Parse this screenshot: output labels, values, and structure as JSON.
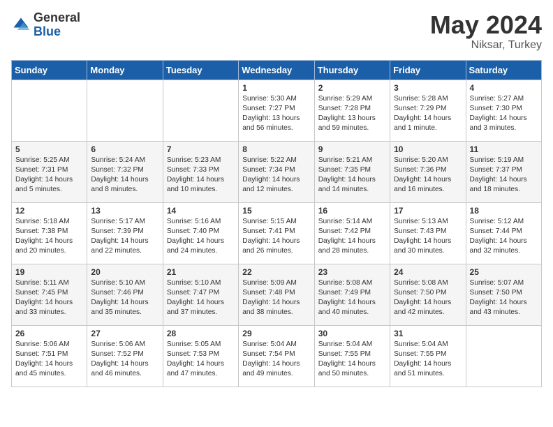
{
  "logo": {
    "general": "General",
    "blue": "Blue"
  },
  "title": "May 2024",
  "subtitle": "Niksar, Turkey",
  "days_header": [
    "Sunday",
    "Monday",
    "Tuesday",
    "Wednesday",
    "Thursday",
    "Friday",
    "Saturday"
  ],
  "weeks": [
    [
      {
        "day": "",
        "sunrise": "",
        "sunset": "",
        "daylight": ""
      },
      {
        "day": "",
        "sunrise": "",
        "sunset": "",
        "daylight": ""
      },
      {
        "day": "",
        "sunrise": "",
        "sunset": "",
        "daylight": ""
      },
      {
        "day": "1",
        "sunrise": "Sunrise: 5:30 AM",
        "sunset": "Sunset: 7:27 PM",
        "daylight": "Daylight: 13 hours and 56 minutes."
      },
      {
        "day": "2",
        "sunrise": "Sunrise: 5:29 AM",
        "sunset": "Sunset: 7:28 PM",
        "daylight": "Daylight: 13 hours and 59 minutes."
      },
      {
        "day": "3",
        "sunrise": "Sunrise: 5:28 AM",
        "sunset": "Sunset: 7:29 PM",
        "daylight": "Daylight: 14 hours and 1 minute."
      },
      {
        "day": "4",
        "sunrise": "Sunrise: 5:27 AM",
        "sunset": "Sunset: 7:30 PM",
        "daylight": "Daylight: 14 hours and 3 minutes."
      }
    ],
    [
      {
        "day": "5",
        "sunrise": "Sunrise: 5:25 AM",
        "sunset": "Sunset: 7:31 PM",
        "daylight": "Daylight: 14 hours and 5 minutes."
      },
      {
        "day": "6",
        "sunrise": "Sunrise: 5:24 AM",
        "sunset": "Sunset: 7:32 PM",
        "daylight": "Daylight: 14 hours and 8 minutes."
      },
      {
        "day": "7",
        "sunrise": "Sunrise: 5:23 AM",
        "sunset": "Sunset: 7:33 PM",
        "daylight": "Daylight: 14 hours and 10 minutes."
      },
      {
        "day": "8",
        "sunrise": "Sunrise: 5:22 AM",
        "sunset": "Sunset: 7:34 PM",
        "daylight": "Daylight: 14 hours and 12 minutes."
      },
      {
        "day": "9",
        "sunrise": "Sunrise: 5:21 AM",
        "sunset": "Sunset: 7:35 PM",
        "daylight": "Daylight: 14 hours and 14 minutes."
      },
      {
        "day": "10",
        "sunrise": "Sunrise: 5:20 AM",
        "sunset": "Sunset: 7:36 PM",
        "daylight": "Daylight: 14 hours and 16 minutes."
      },
      {
        "day": "11",
        "sunrise": "Sunrise: 5:19 AM",
        "sunset": "Sunset: 7:37 PM",
        "daylight": "Daylight: 14 hours and 18 minutes."
      }
    ],
    [
      {
        "day": "12",
        "sunrise": "Sunrise: 5:18 AM",
        "sunset": "Sunset: 7:38 PM",
        "daylight": "Daylight: 14 hours and 20 minutes."
      },
      {
        "day": "13",
        "sunrise": "Sunrise: 5:17 AM",
        "sunset": "Sunset: 7:39 PM",
        "daylight": "Daylight: 14 hours and 22 minutes."
      },
      {
        "day": "14",
        "sunrise": "Sunrise: 5:16 AM",
        "sunset": "Sunset: 7:40 PM",
        "daylight": "Daylight: 14 hours and 24 minutes."
      },
      {
        "day": "15",
        "sunrise": "Sunrise: 5:15 AM",
        "sunset": "Sunset: 7:41 PM",
        "daylight": "Daylight: 14 hours and 26 minutes."
      },
      {
        "day": "16",
        "sunrise": "Sunrise: 5:14 AM",
        "sunset": "Sunset: 7:42 PM",
        "daylight": "Daylight: 14 hours and 28 minutes."
      },
      {
        "day": "17",
        "sunrise": "Sunrise: 5:13 AM",
        "sunset": "Sunset: 7:43 PM",
        "daylight": "Daylight: 14 hours and 30 minutes."
      },
      {
        "day": "18",
        "sunrise": "Sunrise: 5:12 AM",
        "sunset": "Sunset: 7:44 PM",
        "daylight": "Daylight: 14 hours and 32 minutes."
      }
    ],
    [
      {
        "day": "19",
        "sunrise": "Sunrise: 5:11 AM",
        "sunset": "Sunset: 7:45 PM",
        "daylight": "Daylight: 14 hours and 33 minutes."
      },
      {
        "day": "20",
        "sunrise": "Sunrise: 5:10 AM",
        "sunset": "Sunset: 7:46 PM",
        "daylight": "Daylight: 14 hours and 35 minutes."
      },
      {
        "day": "21",
        "sunrise": "Sunrise: 5:10 AM",
        "sunset": "Sunset: 7:47 PM",
        "daylight": "Daylight: 14 hours and 37 minutes."
      },
      {
        "day": "22",
        "sunrise": "Sunrise: 5:09 AM",
        "sunset": "Sunset: 7:48 PM",
        "daylight": "Daylight: 14 hours and 38 minutes."
      },
      {
        "day": "23",
        "sunrise": "Sunrise: 5:08 AM",
        "sunset": "Sunset: 7:49 PM",
        "daylight": "Daylight: 14 hours and 40 minutes."
      },
      {
        "day": "24",
        "sunrise": "Sunrise: 5:08 AM",
        "sunset": "Sunset: 7:50 PM",
        "daylight": "Daylight: 14 hours and 42 minutes."
      },
      {
        "day": "25",
        "sunrise": "Sunrise: 5:07 AM",
        "sunset": "Sunset: 7:50 PM",
        "daylight": "Daylight: 14 hours and 43 minutes."
      }
    ],
    [
      {
        "day": "26",
        "sunrise": "Sunrise: 5:06 AM",
        "sunset": "Sunset: 7:51 PM",
        "daylight": "Daylight: 14 hours and 45 minutes."
      },
      {
        "day": "27",
        "sunrise": "Sunrise: 5:06 AM",
        "sunset": "Sunset: 7:52 PM",
        "daylight": "Daylight: 14 hours and 46 minutes."
      },
      {
        "day": "28",
        "sunrise": "Sunrise: 5:05 AM",
        "sunset": "Sunset: 7:53 PM",
        "daylight": "Daylight: 14 hours and 47 minutes."
      },
      {
        "day": "29",
        "sunrise": "Sunrise: 5:04 AM",
        "sunset": "Sunset: 7:54 PM",
        "daylight": "Daylight: 14 hours and 49 minutes."
      },
      {
        "day": "30",
        "sunrise": "Sunrise: 5:04 AM",
        "sunset": "Sunset: 7:55 PM",
        "daylight": "Daylight: 14 hours and 50 minutes."
      },
      {
        "day": "31",
        "sunrise": "Sunrise: 5:04 AM",
        "sunset": "Sunset: 7:55 PM",
        "daylight": "Daylight: 14 hours and 51 minutes."
      },
      {
        "day": "",
        "sunrise": "",
        "sunset": "",
        "daylight": ""
      }
    ]
  ]
}
